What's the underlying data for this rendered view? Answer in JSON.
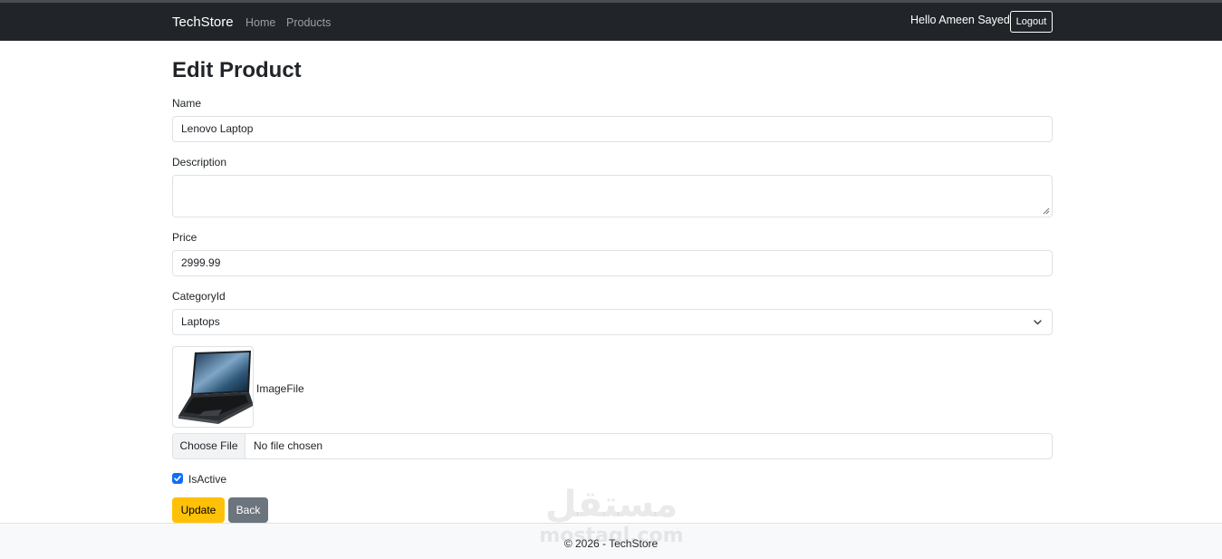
{
  "navbar": {
    "brand": "TechStore",
    "links": [
      "Home",
      "Products"
    ],
    "greeting": "Hello Ameen Sayed",
    "logout_label": "Logout"
  },
  "page": {
    "title": "Edit Product"
  },
  "form": {
    "name": {
      "label": "Name",
      "value": "Lenovo Laptop"
    },
    "description": {
      "label": "Description",
      "value": ""
    },
    "price": {
      "label": "Price",
      "value": "2999.99"
    },
    "category": {
      "label": "CategoryId",
      "selected": "Laptops"
    },
    "image": {
      "label": "ImageFile",
      "choose_label": "Choose File",
      "status": "No file chosen"
    },
    "is_active": {
      "label": "IsActive",
      "checked": true
    },
    "update_label": "Update",
    "back_label": "Back"
  },
  "footer": {
    "text": "© 2026 - TechStore"
  },
  "watermark": {
    "arabic": "مستقل",
    "latin": "mostaql.com"
  },
  "colors": {
    "navbar_bg": "#212529",
    "update_button": "#ffc107",
    "back_button": "#6c757d",
    "checkbox": "#0d6efd"
  }
}
